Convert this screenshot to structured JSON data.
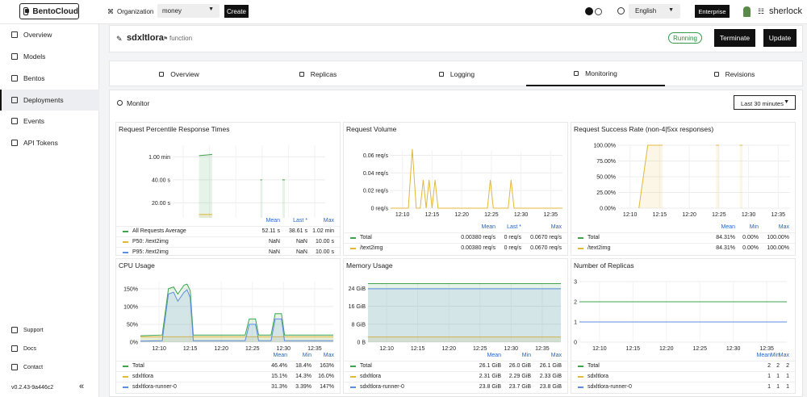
{
  "topbar": {
    "brand": "BentoCloud",
    "org_label": "Organization",
    "org_value": "money",
    "create_label": "Create",
    "language": "English",
    "enterprise_label": "Enterprise",
    "username": "sherlock"
  },
  "sidebar": {
    "items": [
      {
        "label": "Overview",
        "icon": "overview-icon"
      },
      {
        "label": "Models",
        "icon": "models-icon"
      },
      {
        "label": "Bentos",
        "icon": "bentos-icon"
      },
      {
        "label": "Deployments",
        "icon": "deployments-icon"
      },
      {
        "label": "Events",
        "icon": "events-icon"
      },
      {
        "label": "API Tokens",
        "icon": "key-icon"
      }
    ],
    "active_index": 3,
    "support_label": "Support",
    "docs_label": "Docs",
    "contact_label": "Contact",
    "version": "v0.2.43-9a446c2"
  },
  "header": {
    "name": "sdxltlora",
    "type": "function",
    "status": "Running",
    "status_color": "#2c8a3c",
    "terminate_label": "Terminate",
    "update_label": "Update"
  },
  "tabs": [
    {
      "label": "Overview"
    },
    {
      "label": "Replicas"
    },
    {
      "label": "Logging"
    },
    {
      "label": "Monitoring"
    },
    {
      "label": "Revisions"
    }
  ],
  "active_tab": 3,
  "monitor": {
    "title": "Monitor",
    "time_range": "Last 30 minutes"
  },
  "colors": {
    "green": "#3fa34d",
    "yellow": "#e0b83a",
    "blue": "#5b8de0"
  },
  "chart_data": [
    {
      "id": "percentile",
      "type": "line",
      "title": "Request Percentile Response Times",
      "x_ticks": [
        "12:10",
        "12:15",
        "12:20",
        "12:25",
        "12:30",
        "12:35"
      ],
      "y_ticks": [
        "1.00 min",
        "40.00 s",
        "20.00 s"
      ],
      "y_tick_values": [
        60,
        40,
        20
      ],
      "ylim": [
        0,
        70
      ],
      "x_range": [
        "12:08",
        "12:37"
      ],
      "columns": [
        "Mean",
        "Last *",
        "Max"
      ],
      "series": [
        {
          "name": "All Requests Average",
          "color": "#3fa34d",
          "stats": [
            "52.11 s",
            "38.61 s",
            "1.02 min"
          ],
          "points": [
            [
              "12:13:00",
              61
            ],
            [
              "12:15:30",
              62
            ],
            [
              "12:15:31",
              null
            ],
            [
              "12:24:40",
              40
            ],
            [
              "12:25:00",
              40
            ],
            [
              "12:25:01",
              null
            ],
            [
              "12:28:50",
              40
            ],
            [
              "12:29:20",
              40
            ]
          ]
        },
        {
          "name": "P50: /text2img",
          "color": "#e0b83a",
          "stats": [
            "NaN",
            "NaN",
            "10.00 s"
          ],
          "points": [
            [
              "12:13:00",
              10
            ],
            [
              "12:15:30",
              10
            ]
          ]
        },
        {
          "name": "P95: /text2img",
          "color": "#5b8de0",
          "stats": [
            "NaN",
            "NaN",
            "10.00 s"
          ],
          "points": []
        }
      ]
    },
    {
      "id": "volume",
      "type": "line",
      "title": "Request Volume",
      "x_ticks": [
        "12:10",
        "12:15",
        "12:20",
        "12:25",
        "12:30",
        "12:35"
      ],
      "y_ticks": [
        "0.06 req/s",
        "0.04 req/s",
        "0.02 req/s",
        "0 req/s"
      ],
      "y_tick_values": [
        0.06,
        0.04,
        0.02,
        0
      ],
      "ylim": [
        0,
        0.065
      ],
      "x_range": [
        "12:08",
        "12:37"
      ],
      "columns": [
        "Mean",
        "Last *",
        "Max"
      ],
      "series": [
        {
          "name": "Total",
          "color": "#3fa34d",
          "stats": [
            "0.00380 req/s",
            "0 req/s",
            "0.0670 req/s"
          ],
          "points": []
        },
        {
          "name": "/text2img",
          "color": "#e0b83a",
          "stats": [
            "0.00380 req/s",
            "0 req/s",
            "0.0670 req/s"
          ],
          "points": [
            [
              "12:08:00",
              0
            ],
            [
              "12:11:00",
              0
            ],
            [
              "12:11:40",
              0.067
            ],
            [
              "12:12:20",
              0
            ],
            [
              "12:13:00",
              0
            ],
            [
              "12:13:30",
              0.032
            ],
            [
              "12:14:00",
              0
            ],
            [
              "12:14:30",
              0.032
            ],
            [
              "12:15:00",
              0
            ],
            [
              "12:15:30",
              0.032
            ],
            [
              "12:16:00",
              0
            ],
            [
              "12:24:20",
              0
            ],
            [
              "12:24:50",
              0.032
            ],
            [
              "12:25:20",
              0
            ],
            [
              "12:27:50",
              0
            ],
            [
              "12:28:20",
              0.032
            ],
            [
              "12:28:50",
              0
            ],
            [
              "12:37:00",
              0
            ]
          ]
        }
      ]
    },
    {
      "id": "success",
      "type": "area",
      "title": "Request Success Rate (non-4|5xx responses)",
      "x_ticks": [
        "12:10",
        "12:15",
        "12:20",
        "12:25",
        "12:30",
        "12:35"
      ],
      "y_ticks": [
        "100.00%",
        "75.00%",
        "50.00%",
        "25.00%",
        "0.00%"
      ],
      "y_tick_values": [
        100,
        75,
        50,
        25,
        0
      ],
      "ylim": [
        0,
        100
      ],
      "x_range": [
        "12:08",
        "12:37"
      ],
      "columns": [
        "Mean",
        "Min",
        "Max"
      ],
      "series": [
        {
          "name": "Total",
          "color": "#3fa34d",
          "stats": [
            "84.31%",
            "0.00%",
            "100.00%"
          ],
          "points": []
        },
        {
          "name": "/text2img",
          "color": "#e0b83a",
          "stats": [
            "84.31%",
            "0.00%",
            "100.00%"
          ],
          "points": [
            [
              "12:11:30",
              0
            ],
            [
              "12:13:00",
              100
            ],
            [
              "12:15:30",
              100
            ],
            [
              "12:15:31",
              null
            ],
            [
              "12:24:30",
              100
            ],
            [
              "12:25:00",
              100
            ],
            [
              "12:25:01",
              null
            ],
            [
              "12:28:30",
              100
            ],
            [
              "12:29:00",
              100
            ]
          ]
        }
      ]
    },
    {
      "id": "cpu",
      "type": "area",
      "title": "CPU Usage",
      "x_ticks": [
        "12:10",
        "12:15",
        "12:20",
        "12:25",
        "12:30",
        "12:35"
      ],
      "y_ticks": [
        "150%",
        "100%",
        "50%",
        "0%"
      ],
      "y_tick_values": [
        150,
        100,
        50,
        0
      ],
      "ylim": [
        0,
        170
      ],
      "x_range": [
        "12:07",
        "12:38"
      ],
      "columns": [
        "Mean",
        "Min",
        "Max"
      ],
      "series": [
        {
          "name": "Total",
          "color": "#3fa34d",
          "stats": [
            "46.4%",
            "18.4%",
            "163%"
          ],
          "points": [
            [
              "12:07:00",
              18
            ],
            [
              "12:10:30",
              20
            ],
            [
              "12:11:30",
              150
            ],
            [
              "12:12:20",
              155
            ],
            [
              "12:13:00",
              135
            ],
            [
              "12:14:00",
              160
            ],
            [
              "12:14:30",
              163
            ],
            [
              "12:15:00",
              145
            ],
            [
              "12:15:30",
              20
            ],
            [
              "12:23:50",
              20
            ],
            [
              "12:24:30",
              65
            ],
            [
              "12:25:30",
              65
            ],
            [
              "12:26:00",
              20
            ],
            [
              "12:28:00",
              20
            ],
            [
              "12:28:40",
              80
            ],
            [
              "12:29:40",
              80
            ],
            [
              "12:30:10",
              20
            ],
            [
              "12:38:00",
              20
            ]
          ]
        },
        {
          "name": "sdxltlora",
          "color": "#e0b83a",
          "stats": [
            "15.1%",
            "14.3%",
            "16.0%"
          ],
          "points": [
            [
              "12:07:00",
              15
            ],
            [
              "12:38:00",
              15
            ]
          ]
        },
        {
          "name": "sdxltlora-runner-0",
          "color": "#5b8de0",
          "stats": [
            "31.3%",
            "3.39%",
            "147%"
          ],
          "points": [
            [
              "12:07:00",
              3
            ],
            [
              "12:10:30",
              4
            ],
            [
              "12:11:30",
              135
            ],
            [
              "12:12:20",
              140
            ],
            [
              "12:13:00",
              115
            ],
            [
              "12:14:00",
              140
            ],
            [
              "12:14:30",
              147
            ],
            [
              "12:15:00",
              125
            ],
            [
              "12:15:30",
              4
            ],
            [
              "12:23:50",
              4
            ],
            [
              "12:24:30",
              50
            ],
            [
              "12:25:30",
              50
            ],
            [
              "12:26:00",
              4
            ],
            [
              "12:28:00",
              4
            ],
            [
              "12:28:40",
              65
            ],
            [
              "12:29:40",
              65
            ],
            [
              "12:30:10",
              4
            ],
            [
              "12:38:00",
              4
            ]
          ]
        }
      ]
    },
    {
      "id": "memory",
      "type": "area",
      "title": "Memory Usage",
      "x_ticks": [
        "12:10",
        "12:15",
        "12:20",
        "12:25",
        "12:30",
        "12:35"
      ],
      "y_ticks": [
        "24 GiB",
        "16 GiB",
        "8 GiB",
        "0 B"
      ],
      "y_tick_values": [
        24,
        16,
        8,
        0
      ],
      "ylim": [
        0,
        27
      ],
      "x_range": [
        "12:07",
        "12:38"
      ],
      "columns": [
        "Mean",
        "Min",
        "Max"
      ],
      "series": [
        {
          "name": "Total",
          "color": "#3fa34d",
          "stats": [
            "26.1 GiB",
            "26.0 GiB",
            "26.1 GiB"
          ],
          "points": [
            [
              "12:07:00",
              26.1
            ],
            [
              "12:38:00",
              26.1
            ]
          ]
        },
        {
          "name": "sdxltlora",
          "color": "#e0b83a",
          "stats": [
            "2.31 GiB",
            "2.29 GiB",
            "2.33 GiB"
          ],
          "points": [
            [
              "12:07:00",
              2.31
            ],
            [
              "12:38:00",
              2.31
            ]
          ]
        },
        {
          "name": "sdxltlora-runner-0",
          "color": "#5b8de0",
          "stats": [
            "23.8 GiB",
            "23.7 GiB",
            "23.8 GiB"
          ],
          "points": [
            [
              "12:07:00",
              23.8
            ],
            [
              "12:38:00",
              23.8
            ]
          ]
        }
      ]
    },
    {
      "id": "replicas",
      "type": "line",
      "title": "Number of Replicas",
      "x_ticks": [
        "12:10",
        "12:15",
        "12:20",
        "12:25",
        "12:30",
        "12:35"
      ],
      "y_ticks": [
        "3",
        "2",
        "1",
        "0"
      ],
      "y_tick_values": [
        3,
        2,
        1,
        0
      ],
      "ylim": [
        0,
        3
      ],
      "x_range": [
        "12:07",
        "12:38"
      ],
      "columns": [
        "Mean",
        "Min",
        "Max"
      ],
      "series": [
        {
          "name": "Total",
          "color": "#3fa34d",
          "stats": [
            "2",
            "2",
            "2"
          ],
          "points": [
            [
              "12:07:00",
              2
            ],
            [
              "12:38:00",
              2
            ]
          ]
        },
        {
          "name": "sdxltlora",
          "color": "#e0b83a",
          "stats": [
            "1",
            "1",
            "1"
          ],
          "points": []
        },
        {
          "name": "sdxltlora-runner-0",
          "color": "#5b8de0",
          "stats": [
            "1",
            "1",
            "1"
          ],
          "points": [
            [
              "12:07:00",
              1
            ],
            [
              "12:38:00",
              1
            ]
          ]
        }
      ]
    }
  ]
}
